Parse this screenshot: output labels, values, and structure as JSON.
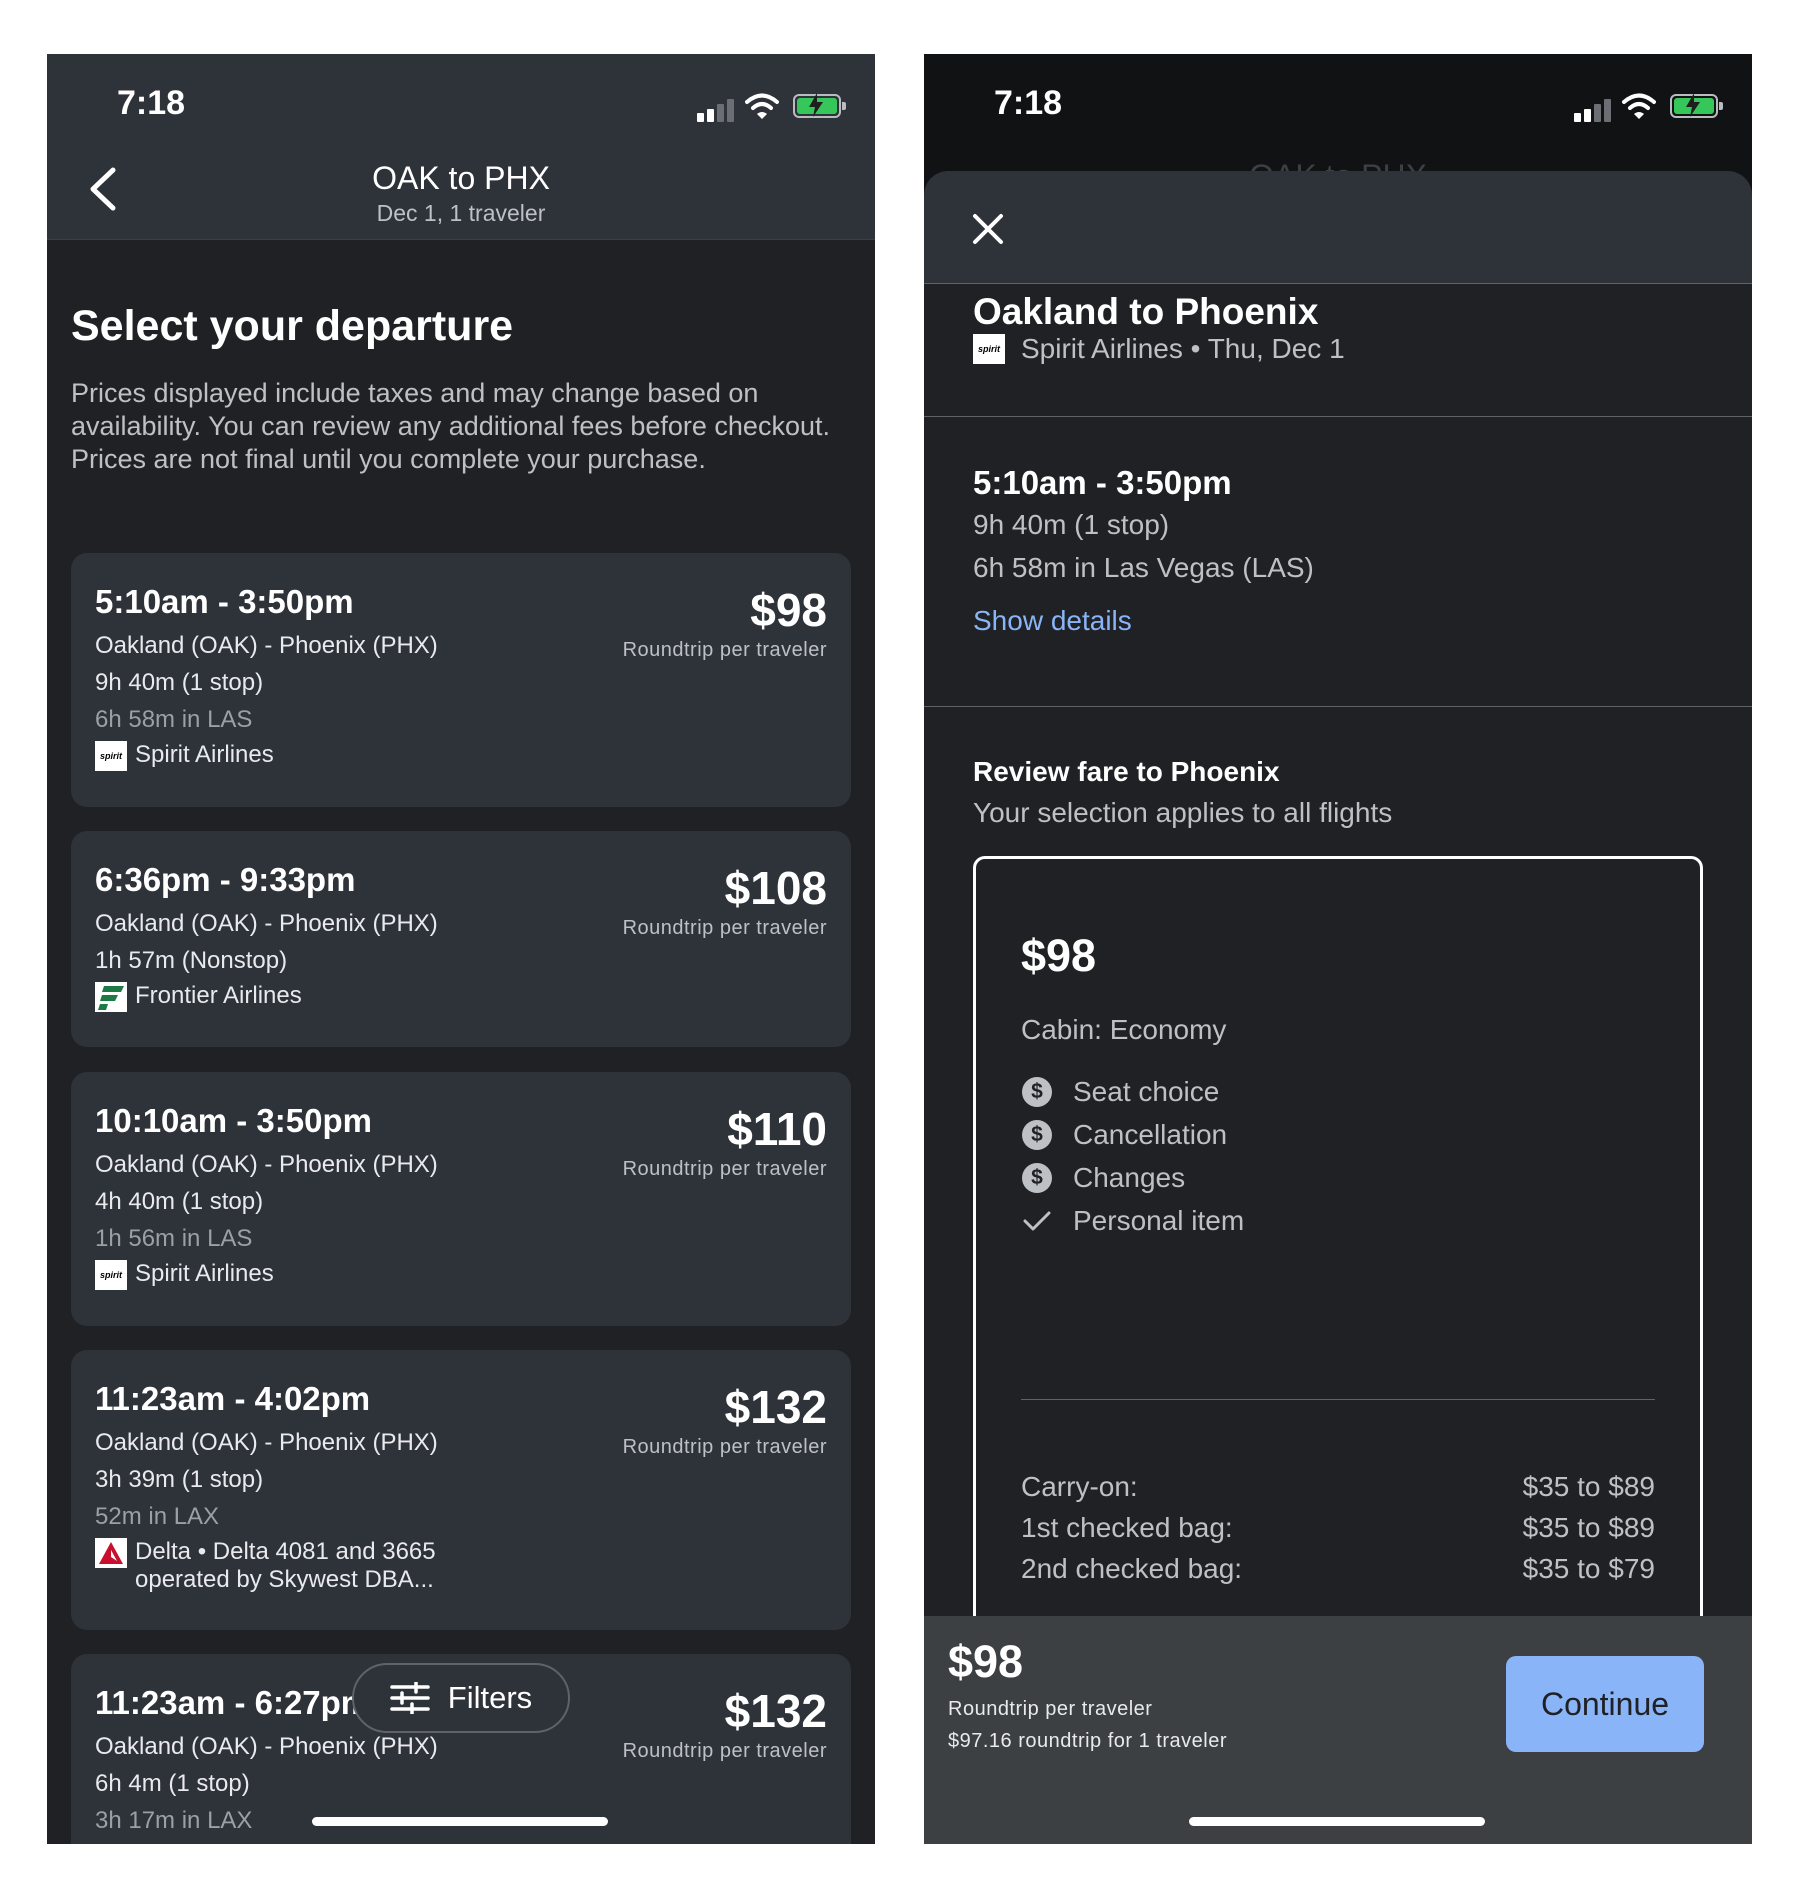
{
  "status_bar": {
    "time": "7:18"
  },
  "left": {
    "nav": {
      "title": "OAK to PHX",
      "subtitle": "Dec 1, 1 traveler"
    },
    "heading": "Select your departure",
    "disclaimer": "Prices displayed include taxes and may change based on availability. You can review any additional fees before checkout. Prices are not final until you complete your purchase.",
    "flights": [
      {
        "times": "5:10am - 3:50pm",
        "route": "Oakland (OAK) - Phoenix (PHX)",
        "duration": "9h 40m (1 stop)",
        "layover": "6h 58m in LAS",
        "airline_line1": "Spirit Airlines",
        "airline_line2": "",
        "price": "$98",
        "price_note": "Roundtrip per traveler",
        "logo": "spirit"
      },
      {
        "times": "6:36pm - 9:33pm",
        "route": "Oakland (OAK) - Phoenix (PHX)",
        "duration": "1h 57m (Nonstop)",
        "layover": "",
        "airline_line1": "Frontier Airlines",
        "airline_line2": "",
        "price": "$108",
        "price_note": "Roundtrip per traveler",
        "logo": "frontier"
      },
      {
        "times": "10:10am - 3:50pm",
        "route": "Oakland (OAK) - Phoenix (PHX)",
        "duration": "4h 40m (1 stop)",
        "layover": "1h 56m in LAS",
        "airline_line1": "Spirit Airlines",
        "airline_line2": "",
        "price": "$110",
        "price_note": "Roundtrip per traveler",
        "logo": "spirit"
      },
      {
        "times": "11:23am - 4:02pm",
        "route": "Oakland (OAK) - Phoenix (PHX)",
        "duration": "3h 39m (1 stop)",
        "layover": "52m in LAX",
        "airline_line1": "Delta • Delta 4081 and 3665",
        "airline_line2": "operated by Skywest DBA...",
        "price": "$132",
        "price_note": "Roundtrip per traveler",
        "logo": "delta"
      },
      {
        "times": "11:23am - 6:27pm",
        "route": "Oakland (OAK) - Phoenix (PHX)",
        "duration": "6h 4m (1 stop)",
        "layover": "3h 17m in LAX",
        "airline_line1": "",
        "airline_line2": "",
        "price": "$132",
        "price_note": "Roundtrip per traveler",
        "logo": "delta"
      }
    ],
    "filters_label": "Filters"
  },
  "right": {
    "ghost_title": "OAK to PHX",
    "title": "Oakland to Phoenix",
    "airline_date": "Spirit Airlines • Thu, Dec 1",
    "times": "5:10am - 3:50pm",
    "duration": "9h 40m (1 stop)",
    "layover": "6h 58m in Las Vegas (LAS)",
    "show_details": "Show details",
    "fare_title": "Review fare to Phoenix",
    "fare_subtitle": "Your selection applies to all flights",
    "fare": {
      "price": "$98",
      "cabin": "Cabin: Economy",
      "features": [
        {
          "label": "Seat choice",
          "icon": "dollar-icon"
        },
        {
          "label": "Cancellation",
          "icon": "dollar-icon"
        },
        {
          "label": "Changes",
          "icon": "dollar-icon"
        },
        {
          "label": "Personal item",
          "icon": "check-icon"
        }
      ],
      "bags": [
        {
          "label": "Carry-on:",
          "value": "$35 to $89"
        },
        {
          "label": "1st checked bag:",
          "value": "$35 to $89"
        },
        {
          "label": "2nd checked bag:",
          "value": "$35 to $79"
        }
      ]
    },
    "footer": {
      "price": "$98",
      "note": "Roundtrip per traveler",
      "total": "$97.16 roundtrip for 1 traveler",
      "continue_label": "Continue"
    }
  },
  "colors": {
    "accent": "#8ab4f8",
    "battery": "#35c759",
    "card": "#2e3239",
    "background": "#202124"
  }
}
